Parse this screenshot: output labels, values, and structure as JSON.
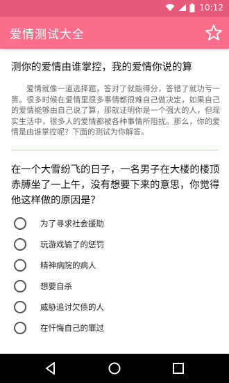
{
  "status_bar": {
    "time": "10:12",
    "icons": [
      "wifi-icon",
      "signal-icon",
      "battery-icon"
    ]
  },
  "app_bar": {
    "title": "爱情测试大全",
    "favorite_icon": "star-outline-icon"
  },
  "test": {
    "title": "测你的爱情由谁掌控，我的爱情你说的算",
    "description": "爱情就像一道选择题，答对了就能得分，答错了就功亏一篑。很多时候在爱情里很多事情都很难自己做决定，如果自己的爱情能够由自己说了算，那就证明你是一个强大的人，但现实生活中，很多人的爱情都被各种事情所阻扰。那么，你的爱情是由谁掌控呢？下面的测试为你解答。",
    "question": "在一个大雪纷飞的日子，一名男子在大楼的楼顶赤膊坐了一上午，没有想要下来的意思，你觉得他这样做的原因是？",
    "options": [
      "为了寻求社会援助",
      "玩游戏输了的惩罚",
      "精神病院的病人",
      "想要自杀",
      "威胁追讨欠债的人",
      "在忏悔自己的罪过"
    ]
  },
  "nav_bar": {
    "buttons": [
      "back-icon",
      "home-icon",
      "recents-icon"
    ]
  },
  "colors": {
    "status_bar": "#e85a7a",
    "app_bar": "#fa6e8c",
    "divider": "#e8c089",
    "nav_bar": "#000000"
  }
}
